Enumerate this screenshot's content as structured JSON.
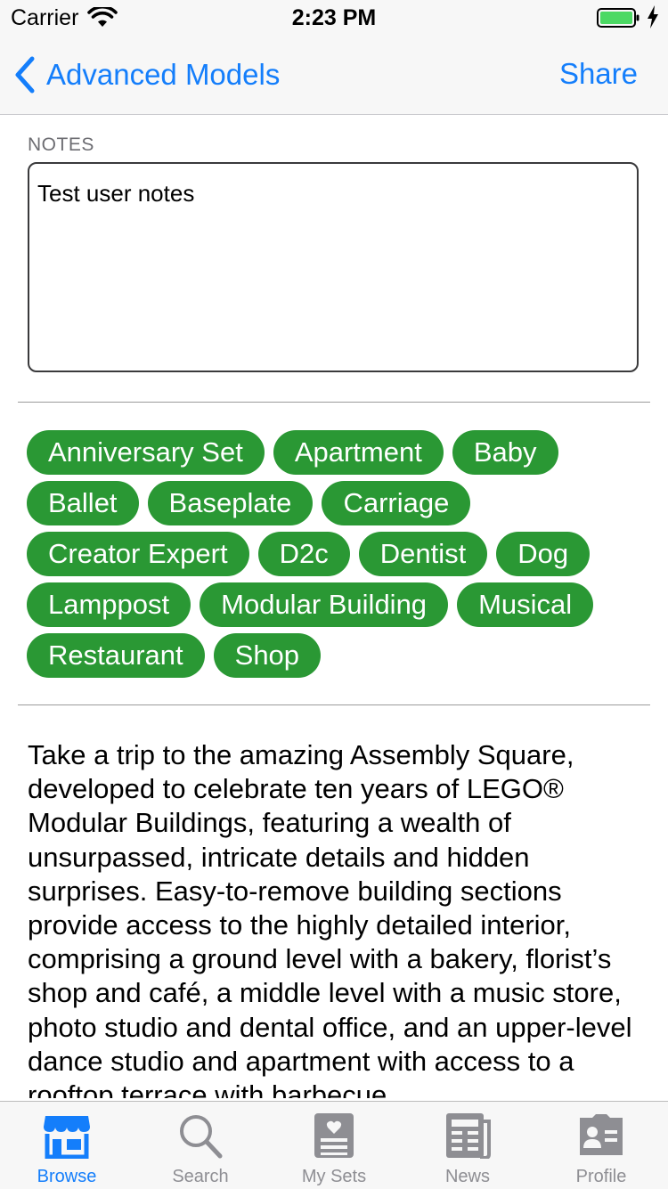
{
  "status_bar": {
    "carrier": "Carrier",
    "time": "2:23 PM",
    "battery_color": "#4cd964"
  },
  "nav": {
    "back_label": "Advanced Models",
    "share_label": "Share",
    "tint_color": "#147efb"
  },
  "notes": {
    "label": "NOTES",
    "value": "Test user notes"
  },
  "tags": {
    "color": "#2a9834",
    "rows": [
      [
        "Anniversary Set",
        "Apartment",
        "Baby"
      ],
      [
        "Ballet",
        "Baseplate",
        "Carriage"
      ],
      [
        "Creator Expert",
        "D2c",
        "Dentist",
        "Dog"
      ],
      [
        "Lamppost",
        "Modular Building",
        "Musical"
      ],
      [
        "Restaurant",
        "Shop"
      ]
    ]
  },
  "description": "Take a trip to the amazing Assembly Square, developed to celebrate ten years of LEGO® Modular Buildings, featuring a wealth of unsurpassed, intricate details and hidden surprises. Easy-to-remove building sections provide access to the highly detailed interior, comprising a ground level with a bakery, florist’s shop and café, a middle level with a music store, photo studio and dental office, and an upper-level dance studio and apartment with access to a rooftop terrace with barbecue",
  "tab_bar": {
    "tabs": [
      {
        "label": "Browse",
        "icon": "storefront-icon",
        "active": true
      },
      {
        "label": "Search",
        "icon": "magnifier-icon",
        "active": false
      },
      {
        "label": "My Sets",
        "icon": "heart-list-icon",
        "active": false
      },
      {
        "label": "News",
        "icon": "newspaper-icon",
        "active": false
      },
      {
        "label": "Profile",
        "icon": "id-card-icon",
        "active": false
      }
    ]
  }
}
